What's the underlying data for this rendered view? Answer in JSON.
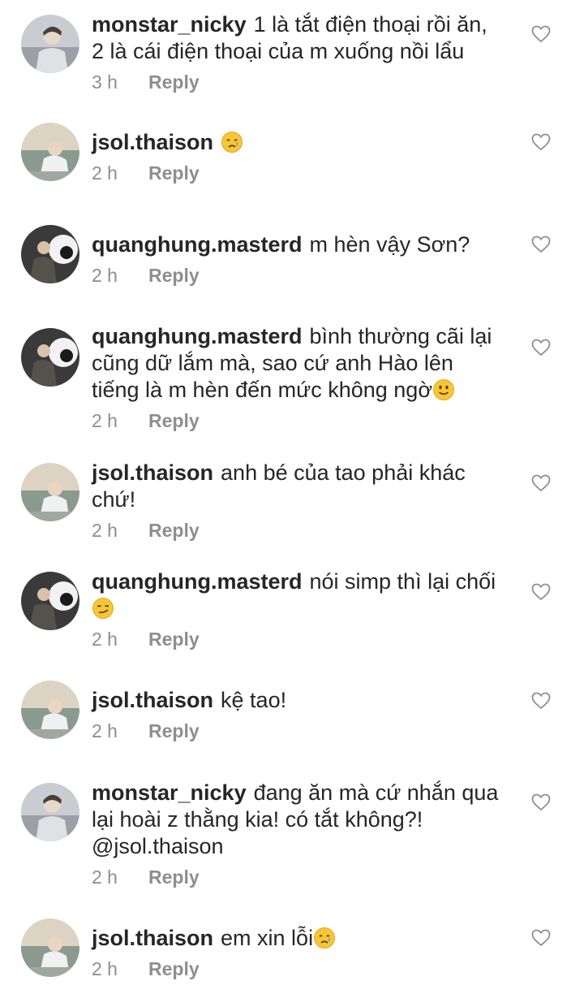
{
  "comments": [
    {
      "id": "c1",
      "username": "monstar_nicky",
      "avatar": "avatar-monstar-nicky",
      "text": "1 là tắt điện thoại rồi ăn, 2 là cái điện thoại của m xuống nồi lẩu",
      "emoji": "",
      "time": "3 h",
      "reply_label": "Reply"
    },
    {
      "id": "c2",
      "username": "jsol.thaison",
      "avatar": "avatar-jsol-thaison",
      "text": "",
      "emoji": "crying-face-emoji",
      "time": "2 h",
      "reply_label": "Reply"
    },
    {
      "id": "c3",
      "username": "quanghung.masterd",
      "avatar": "avatar-quanghung-masterd",
      "text": "m hèn vậy Sơn?",
      "emoji": "",
      "time": "2 h",
      "reply_label": "Reply"
    },
    {
      "id": "c4",
      "username": "quanghung.masterd",
      "avatar": "avatar-quanghung-masterd",
      "text": "bình thường cãi lại cũng dữ lắm mà, sao cứ anh Hào lên tiếng là m hèn đến mức không ngờ",
      "emoji": "slightly-smiling-face-emoji",
      "time": "2 h",
      "reply_label": "Reply"
    },
    {
      "id": "c5",
      "username": "jsol.thaison",
      "avatar": "avatar-jsol-thaison",
      "text": "anh bé của tao phải khác chứ!",
      "emoji": "",
      "time": "2 h",
      "reply_label": "Reply"
    },
    {
      "id": "c6",
      "username": "quanghung.masterd",
      "avatar": "avatar-quanghung-masterd",
      "text": "nói simp thì lại chối",
      "emoji": "smirking-face-emoji",
      "time": "2 h",
      "reply_label": "Reply"
    },
    {
      "id": "c7",
      "username": "jsol.thaison",
      "avatar": "avatar-jsol-thaison",
      "text": "kệ tao!",
      "emoji": "",
      "time": "2 h",
      "reply_label": "Reply"
    },
    {
      "id": "c8",
      "username": "monstar_nicky",
      "avatar": "avatar-monstar-nicky",
      "text": "đang ăn mà cứ nhắn qua lại hoài z thằng kia! có tắt không?! @jsol.thaison",
      "emoji": "",
      "time": "2 h",
      "reply_label": "Reply"
    },
    {
      "id": "c9",
      "username": "jsol.thaison",
      "avatar": "avatar-jsol-thaison",
      "text": "em xin lỗi",
      "emoji": "crying-face-emoji",
      "time": "2 h",
      "reply_label": "Reply"
    }
  ],
  "icons": {
    "like": "heart-outline-icon"
  },
  "colors": {
    "text": "#262626",
    "secondary": "#8e8e8e",
    "background": "#ffffff"
  }
}
